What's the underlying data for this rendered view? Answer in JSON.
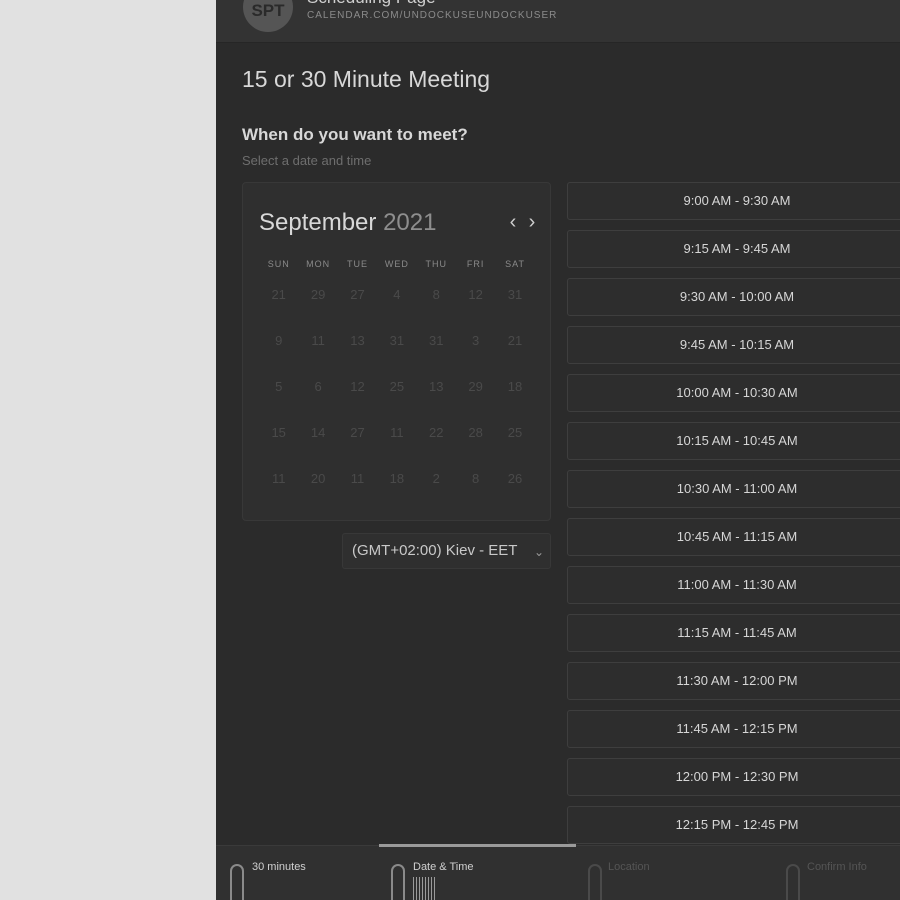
{
  "header": {
    "avatar_initials": "SPT",
    "page_name": "Scheduling Page",
    "page_url": "CALENDAR.COM/UNDOCKUSEUNDOCKUSER"
  },
  "event": {
    "title": "15 or 30 Minute Meeting",
    "question": "When do you want to meet?",
    "subprompt": "Select a date and time"
  },
  "calendar": {
    "month": "September",
    "year": "2021",
    "prev_icon": "chevron-left-icon",
    "next_icon": "chevron-right-icon",
    "weekdays": [
      "SUN",
      "MON",
      "TUE",
      "WED",
      "THU",
      "FRI",
      "SAT"
    ],
    "days": [
      "21",
      "29",
      "27",
      "4",
      "8",
      "12",
      "31",
      "9",
      "11",
      "13",
      "31",
      "31",
      "3",
      "21",
      "5",
      "6",
      "12",
      "25",
      "13",
      "29",
      "18",
      "15",
      "14",
      "27",
      "11",
      "22",
      "28",
      "25",
      "11",
      "20",
      "11",
      "18",
      "2",
      "8",
      "26"
    ]
  },
  "timezone": {
    "selected": "(GMT+02:00) Kiev - EET"
  },
  "time_slots": [
    "9:00 AM - 9:30 AM",
    "9:15 AM - 9:45 AM",
    "9:30 AM - 10:00 AM",
    "9:45 AM - 10:15 AM",
    "10:00 AM - 10:30 AM",
    "10:15 AM - 10:45 AM",
    "10:30 AM - 11:00 AM",
    "10:45 AM - 11:15 AM",
    "11:00 AM - 11:30 AM",
    "11:15 AM - 11:45 AM",
    "11:30 AM - 12:00 PM",
    "11:45 AM - 12:15 PM",
    "12:00 PM - 12:30 PM",
    "12:15 PM - 12:45 PM"
  ],
  "stepper": {
    "steps": [
      {
        "label": "30 minutes",
        "state": "done",
        "icon": "clock-icon"
      },
      {
        "label": "Date & Time",
        "state": "active",
        "icon": "calendar-icon"
      },
      {
        "label": "Location",
        "state": "pending",
        "icon": "location-pin-icon"
      },
      {
        "label": "Confirm Info",
        "state": "pending",
        "icon": "document-icon"
      }
    ]
  },
  "colors": {
    "panel_bg": "#2b2b2b",
    "page_bg": "#e1e1e1",
    "slot_border": "#3e3e3e",
    "text_primary": "#d8d8d8",
    "text_muted": "#6e6e6e"
  }
}
